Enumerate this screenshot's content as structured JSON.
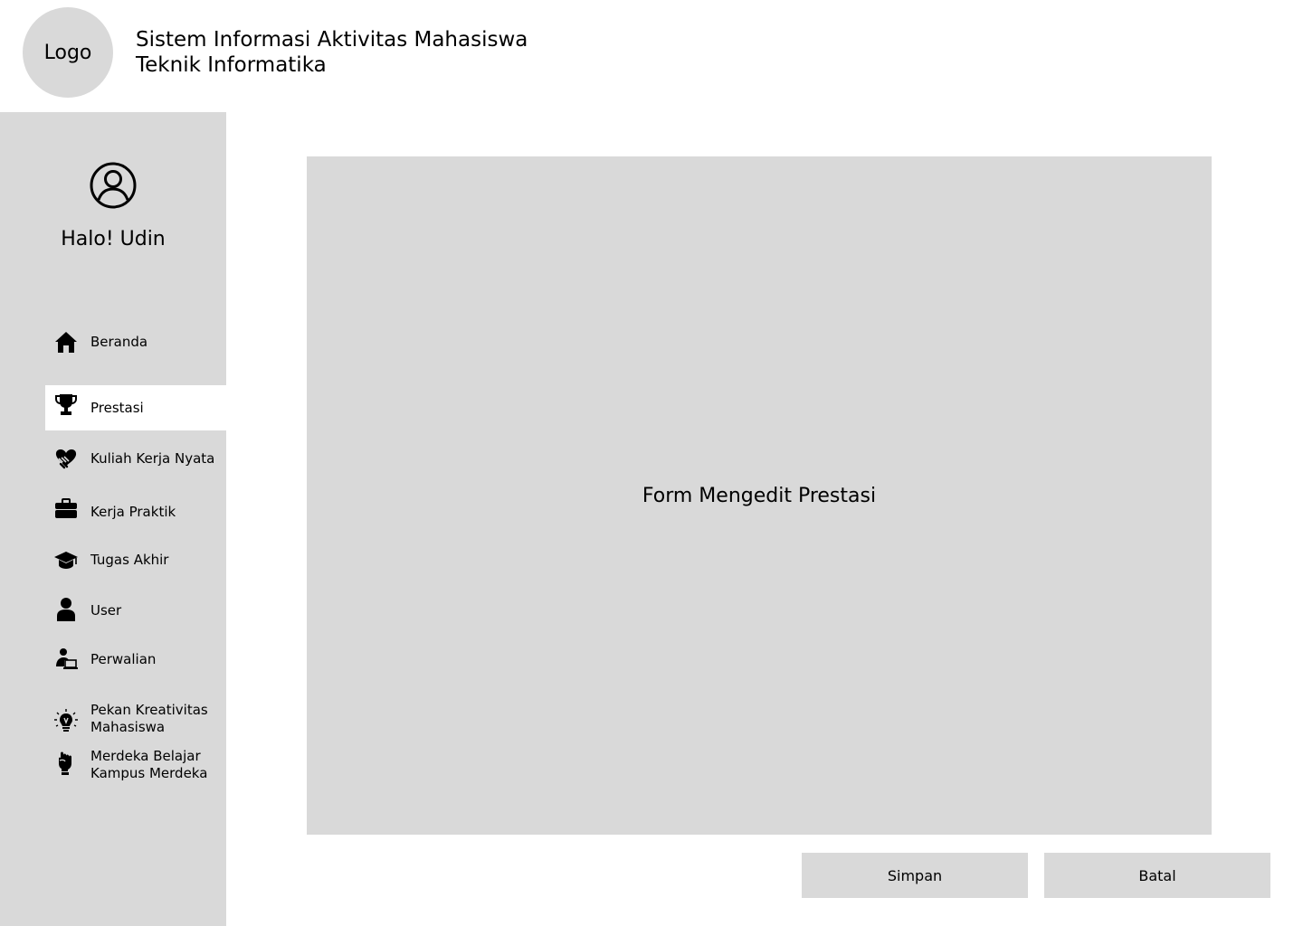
{
  "header": {
    "logo_text": "Logo",
    "title_line1": "Sistem Informasi Aktivitas Mahasiswa",
    "title_line2": "Teknik Informatika"
  },
  "sidebar": {
    "greeting": "Halo! Udin",
    "avatar_icon": "user-circle-icon",
    "items": [
      {
        "label": "Beranda",
        "icon": "home-icon",
        "active": false
      },
      {
        "label": "Prestasi",
        "icon": "trophy-icon",
        "active": true
      },
      {
        "label": "Kuliah Kerja Nyata",
        "icon": "handshake-heart-icon",
        "active": false
      },
      {
        "label": "Kerja Praktik",
        "icon": "briefcase-icon",
        "active": false
      },
      {
        "label": "Tugas Akhir",
        "icon": "graduation-cap-icon",
        "active": false
      },
      {
        "label": "User",
        "icon": "user-icon",
        "active": false
      },
      {
        "label": "Perwalian",
        "icon": "user-laptop-icon",
        "active": false
      },
      {
        "label": "Pekan Kreativitas Mahasiswa",
        "icon": "lightbulb-icon",
        "active": false
      },
      {
        "label": "Merdeka Belajar Kampus Merdeka",
        "icon": "fist-icon",
        "active": false
      }
    ]
  },
  "main": {
    "form_placeholder": "Form Mengedit Prestasi"
  },
  "actions": {
    "save_label": "Simpan",
    "cancel_label": "Batal"
  },
  "colors": {
    "panel_gray": "#d9d9d9",
    "active_item": "#ffffff"
  }
}
